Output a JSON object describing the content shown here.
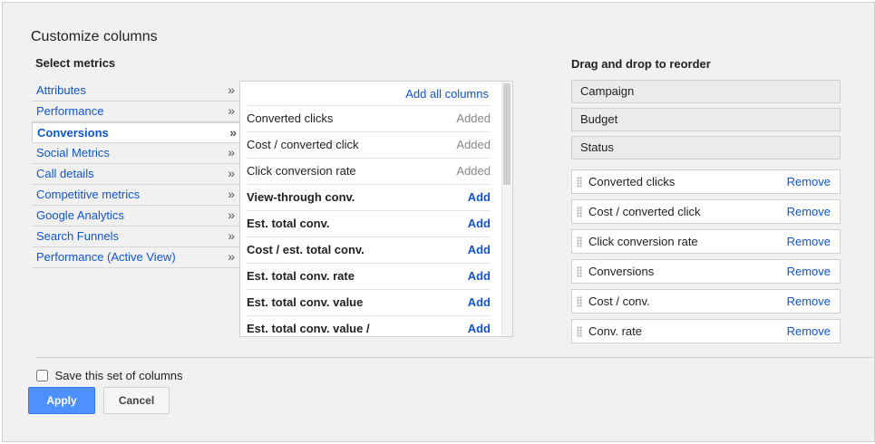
{
  "dialog": {
    "title": "Customize columns",
    "select_title": "Select metrics",
    "reorder_title": "Drag and drop to reorder"
  },
  "categories": [
    {
      "label": "Attributes",
      "selected": false
    },
    {
      "label": "Performance",
      "selected": false
    },
    {
      "label": "Conversions",
      "selected": true
    },
    {
      "label": "Social Metrics",
      "selected": false
    },
    {
      "label": "Call details",
      "selected": false
    },
    {
      "label": "Competitive metrics",
      "selected": false
    },
    {
      "label": "Google Analytics",
      "selected": false
    },
    {
      "label": "Search Funnels",
      "selected": false
    },
    {
      "label": "Performance (Active View)",
      "selected": false
    }
  ],
  "category_arrow": "»",
  "metrics": {
    "add_all_label": "Add all columns",
    "rows": [
      {
        "name": "Converted clicks",
        "status": "Added"
      },
      {
        "name": "Cost / converted click",
        "status": "Added"
      },
      {
        "name": "Click conversion rate",
        "status": "Added"
      },
      {
        "name": "View-through conv.",
        "status": "Add"
      },
      {
        "name": "Est. total conv.",
        "status": "Add"
      },
      {
        "name": "Cost / est. total conv.",
        "status": "Add"
      },
      {
        "name": "Est. total conv. rate",
        "status": "Add"
      },
      {
        "name": "Est. total conv. value",
        "status": "Add"
      },
      {
        "name": "Est. total conv. value /",
        "status": "Add"
      }
    ]
  },
  "fixed_columns": [
    "Campaign",
    "Budget",
    "Status"
  ],
  "selected_columns": {
    "remove_label": "Remove",
    "items": [
      "Converted clicks",
      "Cost / converted click",
      "Click conversion rate",
      "Conversions",
      "Cost / conv.",
      "Conv. rate"
    ]
  },
  "footer": {
    "save_label": "Save this set of columns",
    "apply_label": "Apply",
    "cancel_label": "Cancel"
  },
  "colors": {
    "link": "#1155cc",
    "apply_button": "#4d90fe",
    "dialog_bg": "#f1f1f1"
  }
}
